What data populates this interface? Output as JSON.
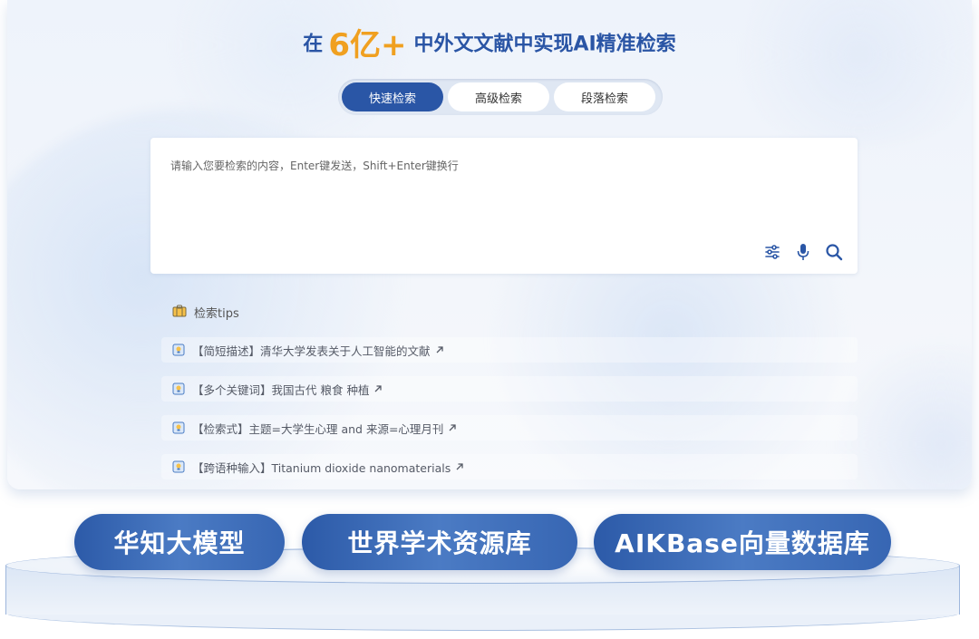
{
  "headline": {
    "prefix": "在",
    "number": "6亿+",
    "suffix": "中外文文献中实现AI精准检索"
  },
  "tabs": [
    {
      "label": "快速检索",
      "active": true
    },
    {
      "label": "高级检索",
      "active": false
    },
    {
      "label": "段落检索",
      "active": false
    }
  ],
  "search": {
    "placeholder": "请输入您要检索的内容，Enter键发送，Shift+Enter键换行",
    "value": "",
    "icons": [
      "filter-sliders-icon",
      "microphone-icon",
      "search-icon"
    ]
  },
  "tips": {
    "title": "检索tips",
    "items": [
      {
        "text": "【简短描述】清华大学发表关于人工智能的文献"
      },
      {
        "text": "【多个关键词】我国古代 粮食 种植"
      },
      {
        "text": "【检索式】主题=大学生心理 and 来源=心理月刊"
      },
      {
        "text": "【跨语种输入】Titanium dioxide nanomaterials"
      }
    ]
  },
  "pills": [
    {
      "label": "华知大模型"
    },
    {
      "label": "世界学术资源库"
    },
    {
      "label": "AIKBase向量数据库"
    }
  ],
  "colors": {
    "primary": "#2a56a6",
    "accent": "#f0a020",
    "headline": "#2a55a5"
  }
}
